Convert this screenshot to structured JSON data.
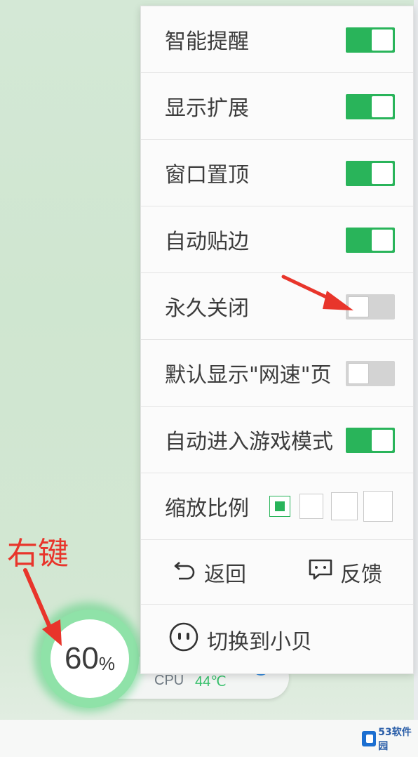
{
  "menu": {
    "rows": [
      {
        "label": "智能提醒",
        "toggle_on": true
      },
      {
        "label": "显示扩展",
        "toggle_on": true
      },
      {
        "label": "窗口置顶",
        "toggle_on": true
      },
      {
        "label": "自动贴边",
        "toggle_on": true
      },
      {
        "label": "永久关闭",
        "toggle_on": false
      },
      {
        "label": "默认显示\"网速\"页",
        "toggle_on": false
      },
      {
        "label": "自动进入游戏模式",
        "toggle_on": true
      }
    ],
    "scale": {
      "label": "缩放比例",
      "options_count": 4,
      "selected_index": 0
    },
    "actions": {
      "back_label": "返回",
      "feedback_label": "反馈"
    },
    "switch_label": "切换到小贝"
  },
  "widget": {
    "usage_value": "60",
    "usage_unit": "%",
    "cpu_label": "CPU",
    "cpu_temp": "44℃"
  },
  "annotation": {
    "text": "右键"
  },
  "watermark": {
    "text": "53软件园"
  },
  "colors": {
    "accent": "#29b45a",
    "annotation": "#e8352b",
    "gauge": "#8fe2a8"
  },
  "icons": {
    "back": "undo-arrow-icon",
    "feedback": "chat-bubble-icon",
    "switch": "robot-face-icon"
  }
}
